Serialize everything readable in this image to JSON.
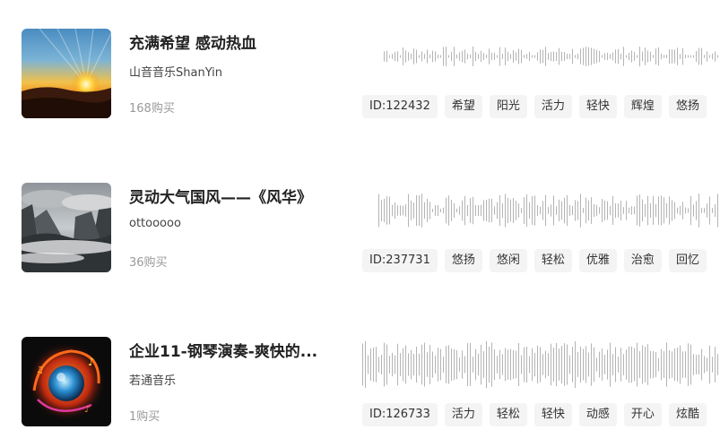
{
  "tracks": [
    {
      "title": "充满希望 感动热血",
      "author": "山音音乐ShanYin",
      "purchases": "168购买",
      "id_tag": "ID:122432",
      "tags": [
        "希望",
        "阳光",
        "活力",
        "轻快",
        "辉煌",
        "悠扬"
      ]
    },
    {
      "title": "灵动大气国风——《风华》",
      "author": "ottooooo",
      "purchases": "36购买",
      "id_tag": "ID:237731",
      "tags": [
        "悠扬",
        "悠闲",
        "轻松",
        "优雅",
        "治愈",
        "回忆"
      ]
    },
    {
      "title": "企业11-钢琴演奏-爽快的...",
      "author": "若通音乐",
      "purchases": "1购买",
      "id_tag": "ID:126733",
      "tags": [
        "活力",
        "轻松",
        "轻快",
        "动感",
        "开心",
        "炫酷"
      ]
    }
  ]
}
